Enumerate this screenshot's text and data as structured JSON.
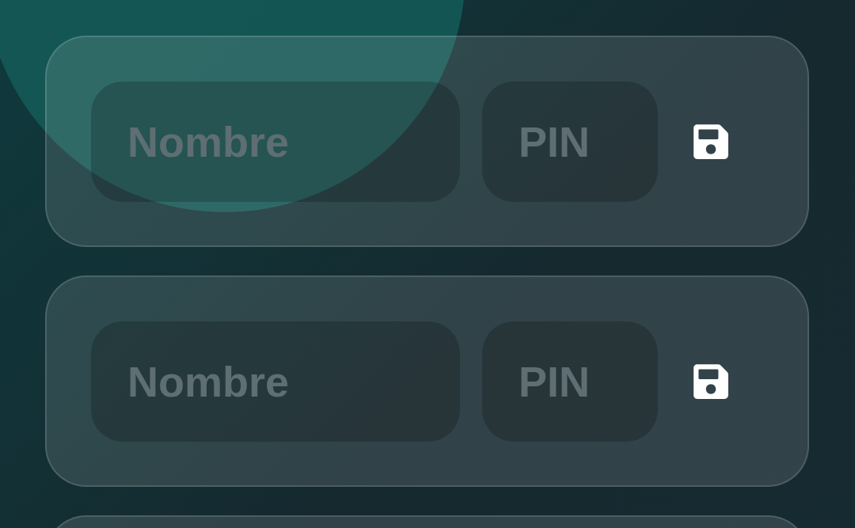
{
  "rows": [
    {
      "kind": "full",
      "name_placeholder": "Nombre",
      "pin_placeholder": "PIN"
    },
    {
      "kind": "full",
      "name_placeholder": "Nombre",
      "pin_placeholder": "PIN"
    },
    {
      "kind": "cut-off"
    }
  ]
}
